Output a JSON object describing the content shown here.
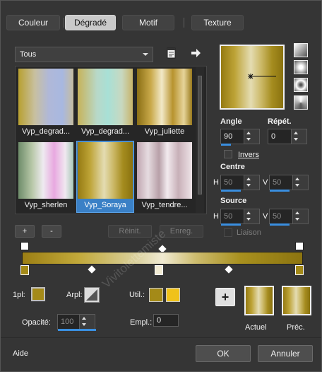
{
  "tabs": [
    {
      "label": "Couleur",
      "active": false
    },
    {
      "label": "Dégradé",
      "active": true
    },
    {
      "label": "Motif",
      "active": false
    },
    {
      "label": "Texture",
      "active": false
    }
  ],
  "category": {
    "value": "Tous"
  },
  "gallery": [
    {
      "name": "Vyp_degrad..."
    },
    {
      "name": "Vyp_degrad..."
    },
    {
      "name": "Vyp_juliette"
    },
    {
      "name": "Vyp_sherlen"
    },
    {
      "name": "Vyp_Soraya",
      "selected": true
    },
    {
      "name": "Vyp_tendre..."
    }
  ],
  "gallery_buttons": {
    "add": "+",
    "remove": "-",
    "reset": "Réinit.",
    "save": "Enreg."
  },
  "angle": {
    "label": "Angle",
    "value": "90",
    "level": 0.25
  },
  "repeat": {
    "label": "Répét.",
    "value": "0"
  },
  "invert": {
    "label": "Invers"
  },
  "center": {
    "label": "Centre",
    "h_label": "H",
    "h_value": "50",
    "v_label": "V",
    "v_value": "50"
  },
  "source": {
    "label": "Source",
    "h_label": "H",
    "h_value": "50",
    "v_label": "V",
    "v_value": "50",
    "link_label": "Liaison"
  },
  "stop_row": {
    "onepl_label": "1pl:",
    "arpl_label": "Arpl:",
    "util_label": "Util.:",
    "opacity_label": "Opacité:",
    "opacity_value": "100",
    "empl_label": "Empl.:",
    "empl_value": "0"
  },
  "util_colors": [
    "#a48a18",
    "#f0c21a"
  ],
  "previews": {
    "add": "+",
    "current": "Actuel",
    "previous": "Préc."
  },
  "footer": {
    "help": "Aide",
    "ok": "OK",
    "cancel": "Annuler"
  },
  "watermark": "Vivitolettemiste",
  "colors": {
    "selection": "#3a80c6",
    "accent": "#3a8fe0",
    "gold_dark": "#9c7f14",
    "gold_light": "#f0ead2"
  }
}
